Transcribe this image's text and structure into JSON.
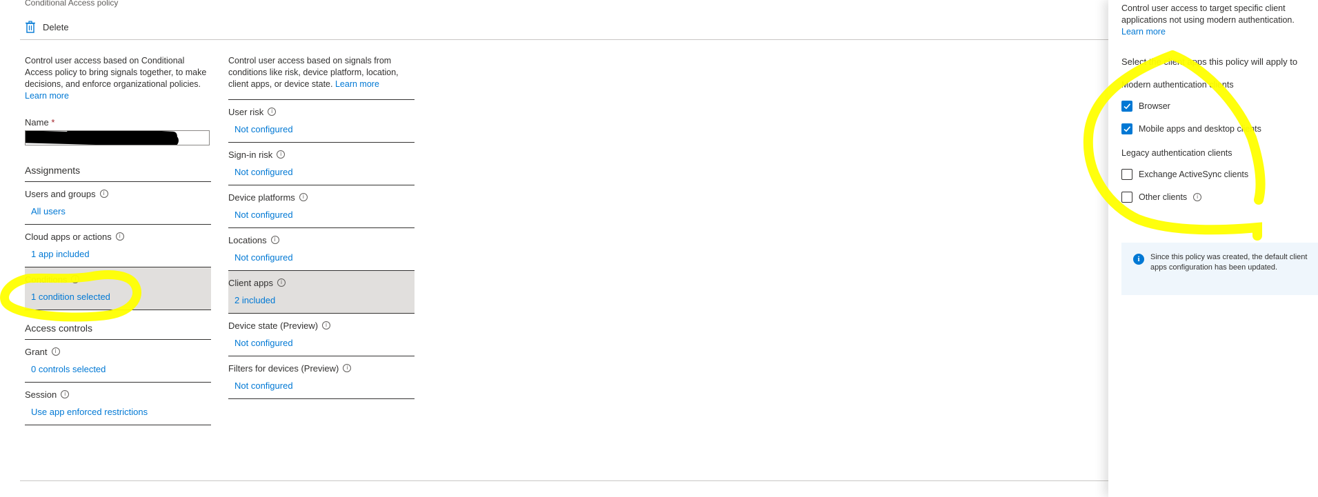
{
  "header": {
    "breadcrumb": "Conditional Access policy",
    "delete_label": "Delete"
  },
  "left": {
    "description": "Control user access based on Conditional Access policy to bring signals together, to make decisions, and enforce organizational policies.",
    "learn_more": "Learn more",
    "name_label": "Name",
    "name_required": "*",
    "assignments_heading": "Assignments",
    "items": [
      {
        "label": "Users and groups",
        "value": "All users"
      },
      {
        "label": "Cloud apps or actions",
        "value": "1 app included"
      },
      {
        "label": "Conditions",
        "value": "1 condition selected"
      }
    ],
    "access_controls_heading": "Access controls",
    "access_items": [
      {
        "label": "Grant",
        "value": "0 controls selected"
      },
      {
        "label": "Session",
        "value": "Use app enforced restrictions"
      }
    ]
  },
  "conditions": {
    "description": "Control user access based on signals from conditions like risk, device platform, location, client apps, or device state.",
    "learn_more": "Learn more",
    "items": [
      {
        "label": "User risk",
        "value": "Not configured"
      },
      {
        "label": "Sign-in risk",
        "value": "Not configured"
      },
      {
        "label": "Device platforms",
        "value": "Not configured"
      },
      {
        "label": "Locations",
        "value": "Not configured"
      },
      {
        "label": "Client apps",
        "value": "2 included"
      },
      {
        "label": "Device state (Preview)",
        "value": "Not configured"
      },
      {
        "label": "Filters for devices (Preview)",
        "value": "Not configured"
      }
    ]
  },
  "panel": {
    "description": "Control user access to target specific client applications not using modern authentication.",
    "learn_more": "Learn more",
    "select_label": "Select the client apps this policy will apply to",
    "modern_heading": "Modern authentication clients",
    "modern": [
      {
        "label": "Browser",
        "checked": true
      },
      {
        "label": "Mobile apps and desktop clients",
        "checked": true
      }
    ],
    "legacy_heading": "Legacy authentication clients",
    "legacy": [
      {
        "label": "Exchange ActiveSync clients",
        "checked": false
      },
      {
        "label": "Other clients",
        "checked": false
      }
    ],
    "info_message": "Since this policy was created, the default client apps configuration has been updated."
  },
  "colors": {
    "accent": "#0078d4",
    "highlight": "#ffff00",
    "selected_bg": "#e1dfdd"
  }
}
